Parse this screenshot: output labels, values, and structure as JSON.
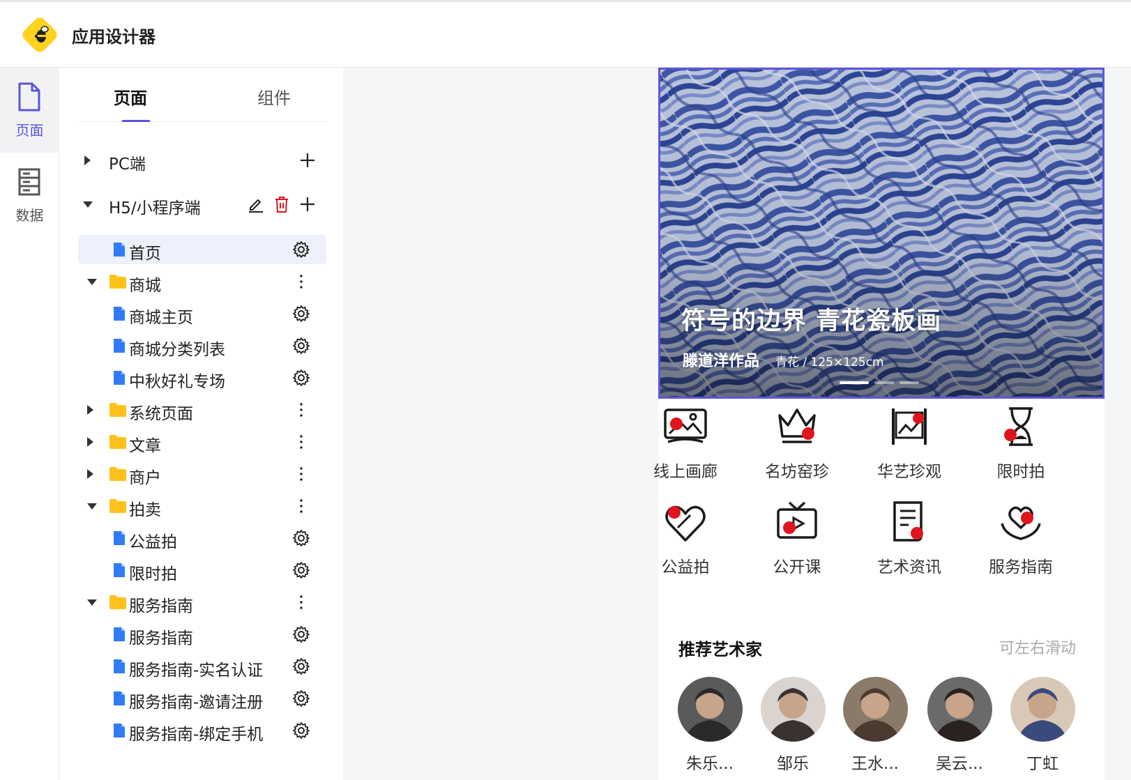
{
  "app": {
    "title": "应用设计器"
  },
  "rail": {
    "items": [
      {
        "label": "页面"
      },
      {
        "label": "数据"
      }
    ]
  },
  "panel": {
    "tabs": [
      {
        "label": "页面"
      },
      {
        "label": "组件"
      }
    ],
    "groups": {
      "pc": "PC端",
      "h5": "H5/小程序端"
    },
    "tree": [
      "首页",
      "商城",
      "商城主页",
      "商城分类列表",
      "中秋好礼专场",
      "系统页面",
      "文章",
      "商户",
      "拍卖",
      "公益拍",
      "限时拍",
      "服务指南",
      "服务指南",
      "服务指南-实名认证",
      "服务指南-邀请注册",
      "服务指南-绑定手机"
    ]
  },
  "preview": {
    "banner": {
      "title": "符号的边界 青花瓷板画",
      "author": "滕道洋作品",
      "meta": "青花 / 125×125cm"
    },
    "grid": [
      "线上画廊",
      "名坊窑珍",
      "华艺珍观",
      "限时拍",
      "公益拍",
      "公开课",
      "艺术资讯",
      "服务指南"
    ],
    "section": {
      "title": "推荐艺术家",
      "hint": "可左右滑动"
    },
    "artists": [
      "朱乐...",
      "邹乐",
      "王水...",
      "吴云...",
      "丁虹"
    ]
  },
  "colors": {
    "accent": "#5a56d8",
    "red": "#e0141e",
    "folder": "#ffc21a",
    "file": "#2f7cf6"
  }
}
